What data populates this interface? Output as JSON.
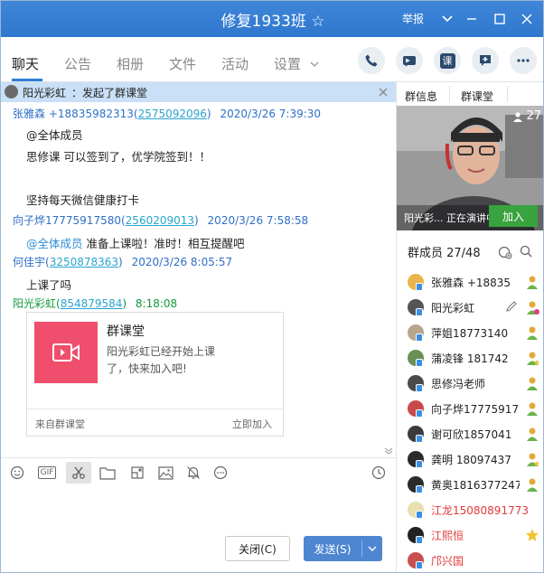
{
  "window": {
    "title": "修复1933班 ☆",
    "report": "举报"
  },
  "tabs": [
    {
      "label": "聊天",
      "active": true
    },
    {
      "label": "公告"
    },
    {
      "label": "相册"
    },
    {
      "label": "文件"
    },
    {
      "label": "活动"
    },
    {
      "label": "设置"
    }
  ],
  "call_buttons": [
    "phone-icon",
    "video-call-icon",
    "class-icon",
    "add-message-icon",
    "more-icon"
  ],
  "call_buttons_text": {
    "class": "课"
  },
  "notice": {
    "name": "阳光彩虹",
    "text": "：发起了群课堂"
  },
  "messages": [
    {
      "sender": "张雅森",
      "phone": "+18835982313(",
      "qq": "2575092096",
      "close": ")",
      "time": "2020/3/26 7:39:30",
      "lines": [
        "@全体成员",
        "思修课  可以签到了，优学院签到！！",
        "",
        "坚持每天微信健康打卡"
      ]
    },
    {
      "sender": "向子烨17775917580(",
      "qq": "2560209013",
      "close": ")",
      "time": "2020/3/26 7:58:58",
      "at": "@全体成员",
      "line": " 准备上课啦！准时！相互提醒吧"
    },
    {
      "sender": "何佳宇(",
      "qq": "3250878363",
      "close": ")",
      "time": "2020/3/26 8:05:57",
      "line": "上课了吗"
    },
    {
      "sender": "阳光彩虹(",
      "qq": "854879584",
      "close": ")",
      "time": "8:18:08"
    }
  ],
  "card": {
    "title": "群课堂",
    "desc1": "阳光彩虹已经开始上课",
    "desc2": "了，快来加入吧!",
    "source": "来自群课堂",
    "join": "立即加入"
  },
  "toolbar": [
    "emoji-icon",
    "gif-icon",
    "scissors-icon",
    "folder-icon",
    "sticker-icon",
    "image-icon",
    "bell-icon",
    "more-icon",
    "history-icon"
  ],
  "toolbar_text": {
    "gif": "GIF"
  },
  "buttons": {
    "close": "关闭(C)",
    "send": "发送(S)"
  },
  "side": {
    "tab_info": "群信息",
    "tab_class": "群课堂",
    "viewers": "27",
    "live_caption": "阳光彩... 正在演讲中",
    "join": "加入",
    "members_title": "群成员 27/48",
    "members": [
      {
        "name": "张雅森 +18835",
        "color": "#e9b44c",
        "role": "admin"
      },
      {
        "name": "阳光彩虹",
        "color": "#555555",
        "role": "owner"
      },
      {
        "name": "萍姐18773140",
        "color": "#b7a68c",
        "role": "member"
      },
      {
        "name": "蒲凌锋 181742",
        "color": "#6a8f55",
        "role": "admin"
      },
      {
        "name": "思修冯老师",
        "color": "#4a4a4a",
        "role": "member"
      },
      {
        "name": "向子烨17775917",
        "color": "#c94a4a",
        "role": "member"
      },
      {
        "name": "谢可欣1857041",
        "color": "#3b3b3b",
        "role": "member"
      },
      {
        "name": "龚明  18097437",
        "color": "#2b2b2b",
        "role": "admin"
      },
      {
        "name": "黄奥1816377247",
        "color": "#2b2b2b",
        "role": "member"
      },
      {
        "name": "江龙15080891773",
        "color": "#e9dfb0",
        "role": "none",
        "red": true
      },
      {
        "name": "江熙恒",
        "color": "#222222",
        "role": "star",
        "red": true
      },
      {
        "name": "邝兴国",
        "color": "#c65050",
        "role": "none",
        "red": true
      }
    ]
  }
}
